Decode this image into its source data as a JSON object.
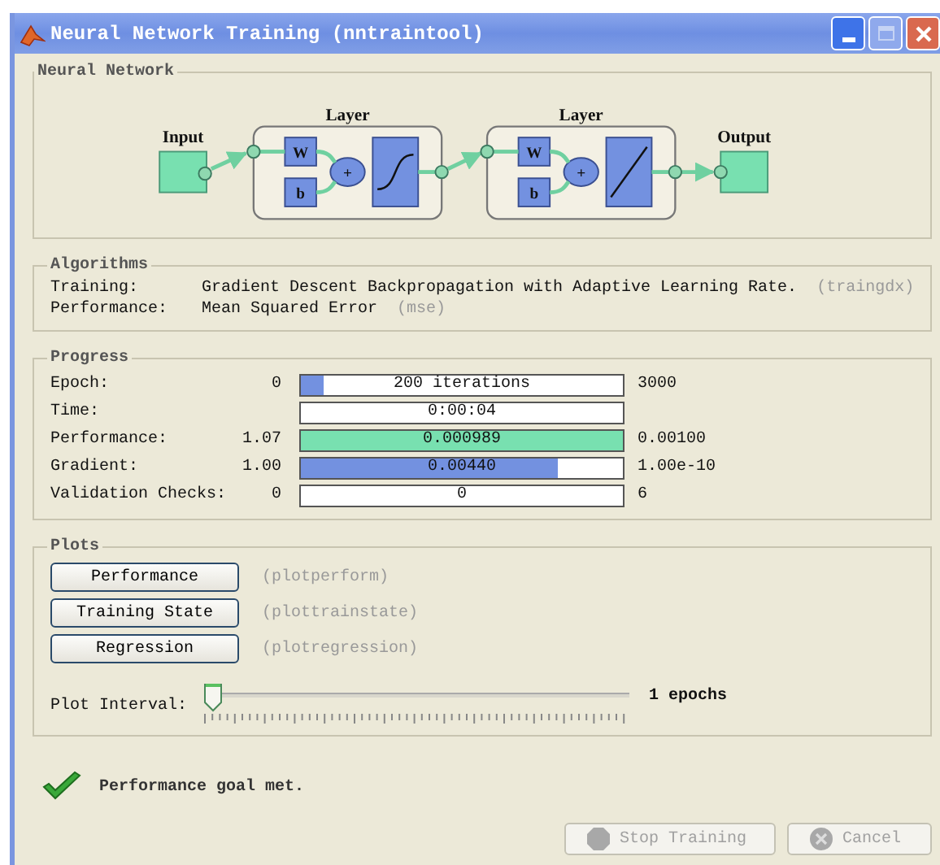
{
  "window": {
    "title": "Neural Network Training (nntraintool)"
  },
  "network": {
    "title": "Neural Network",
    "input": "Input",
    "output": "Output",
    "layers": [
      {
        "label": "Layer",
        "weight": "W",
        "bias": "b",
        "sum": "+",
        "kind": "sigmoid"
      },
      {
        "label": "Layer",
        "weight": "W",
        "bias": "b",
        "sum": "+",
        "kind": "linear"
      }
    ]
  },
  "algorithms": {
    "title": "Algorithms",
    "rows": [
      {
        "label": "Training:",
        "value": "Gradient Descent Backpropagation with Adaptive Learning Rate.",
        "function": "(traingdx)"
      },
      {
        "label": "Performance:",
        "value": "Mean Squared Error",
        "function": "(mse)"
      }
    ]
  },
  "progress": {
    "title": "Progress",
    "rows": [
      {
        "label": "Epoch:",
        "start": "0",
        "reading": "200 iterations",
        "end": "3000",
        "level": 0.07,
        "color": "#7391e0"
      },
      {
        "label": "Time:",
        "reading": "0:00:04"
      },
      {
        "label": "Performance:",
        "start": "1.07",
        "reading": "0.000989",
        "end": "0.00100",
        "level": 1,
        "color": "#78e0b0"
      },
      {
        "label": "Gradient:",
        "start": "1.00",
        "reading": "0.00440",
        "end": "1.00e-10",
        "level": 0.8,
        "color": "#7391e0"
      },
      {
        "label": "Validation Checks:",
        "start": "0",
        "reading": "0",
        "end": "6"
      }
    ]
  },
  "plots": {
    "title": "Plots",
    "buttons": [
      {
        "label": "Performance",
        "function": "(plotperform)"
      },
      {
        "label": "Training State",
        "function": "(plottrainstate)"
      },
      {
        "label": "Regression",
        "function": "(plotregression)"
      }
    ],
    "interval": {
      "label": "Plot Interval:",
      "level": 0,
      "reading": "1 epochs"
    }
  },
  "status": {
    "kind": "success",
    "message": "Performance goal met."
  },
  "buttons": [
    {
      "label": "Stop Training",
      "kind": "stop",
      "disabled": true
    },
    {
      "label": "Cancel",
      "kind": "cancel",
      "disabled": true
    }
  ]
}
